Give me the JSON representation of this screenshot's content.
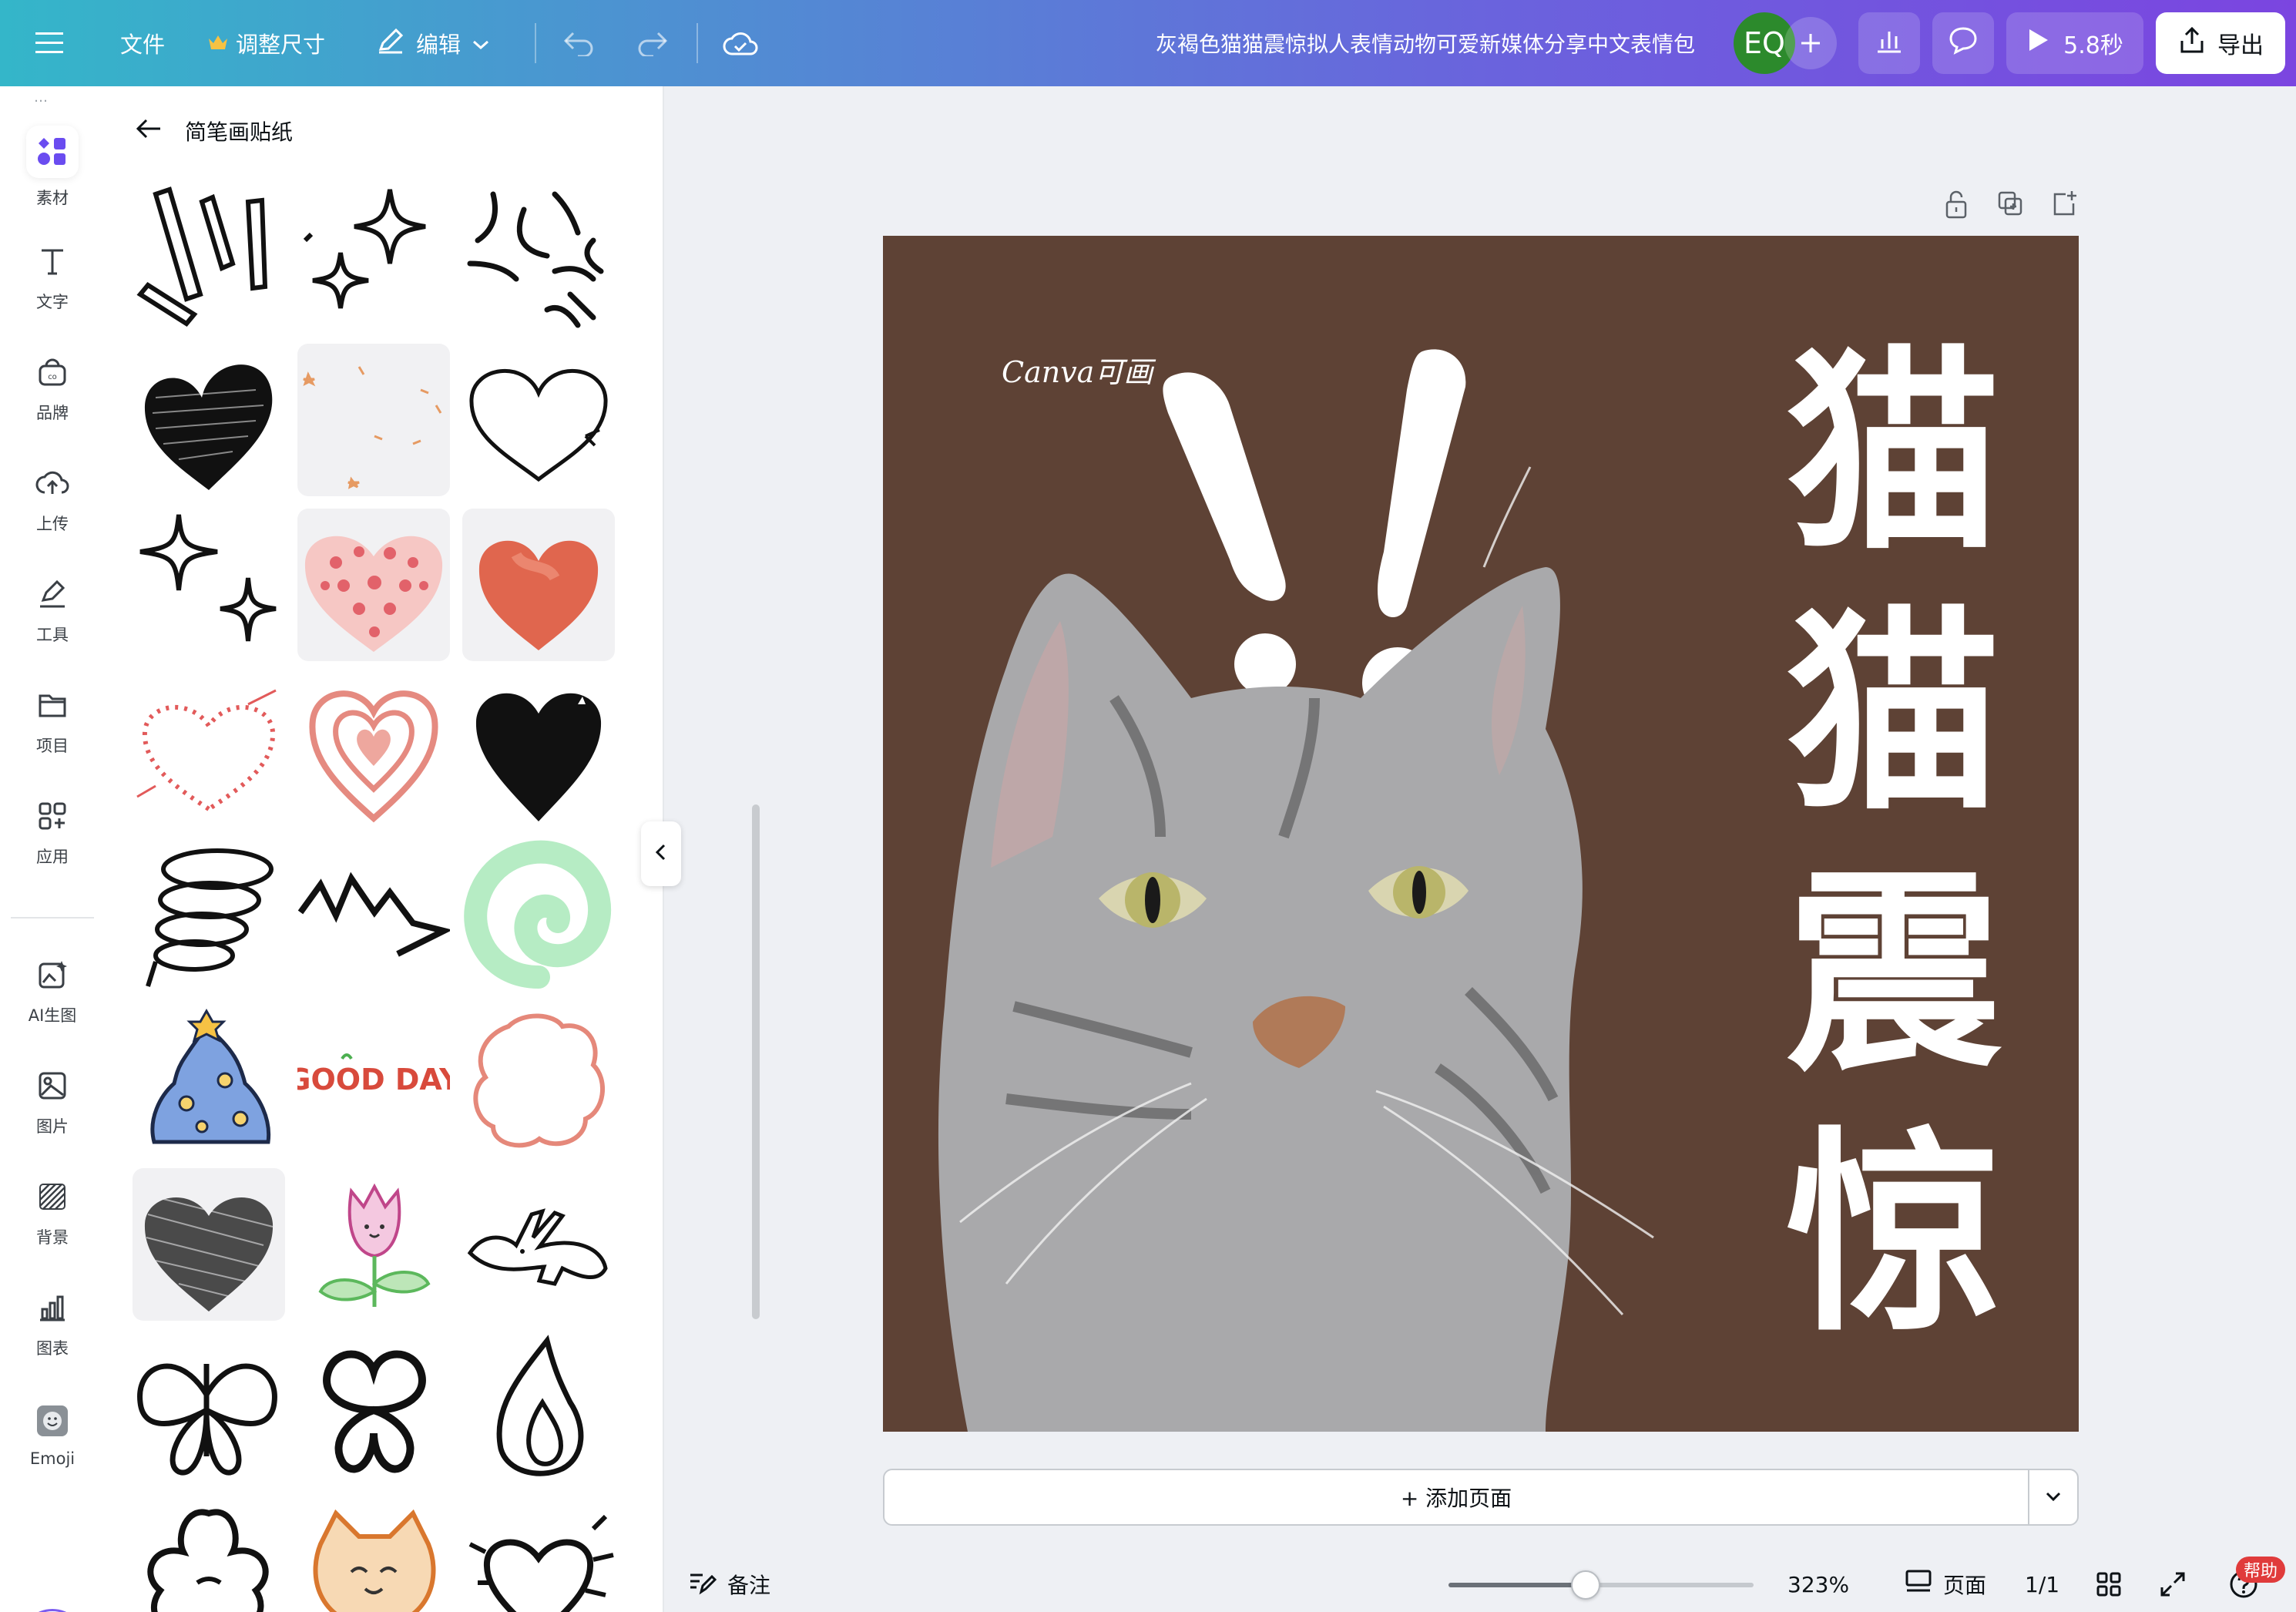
{
  "topbar": {
    "menu_icon": "hamburger-icon",
    "file_label": "文件",
    "resize_label": "调整尺寸",
    "edit_label": "编辑",
    "design_title": "灰褐色猫猫震惊拟人表情动物可爱新媒体分享中文表情包",
    "avatar_initials": "EQ",
    "play_label": "5.8秒",
    "export_label": "导出",
    "crown_color": "#f6c244"
  },
  "rail": {
    "items": [
      {
        "label": "素材",
        "icon": "elements-icon"
      },
      {
        "label": "文字",
        "icon": "text-icon"
      },
      {
        "label": "品牌",
        "icon": "brand-icon"
      },
      {
        "label": "上传",
        "icon": "upload-icon"
      },
      {
        "label": "工具",
        "icon": "draw-tool-icon"
      },
      {
        "label": "项目",
        "icon": "folder-icon"
      },
      {
        "label": "应用",
        "icon": "apps-icon"
      },
      {
        "label": "AI生图",
        "icon": "ai-image-icon"
      },
      {
        "label": "图片",
        "icon": "image-icon"
      },
      {
        "label": "背景",
        "icon": "background-icon"
      },
      {
        "label": "图表",
        "icon": "chart-icon"
      },
      {
        "label": "Emoji",
        "icon": "emoji-icon"
      }
    ],
    "accent": "#6a4cf0"
  },
  "panel": {
    "title": "简笔画贴纸",
    "good_day_text": "GOOD DAY"
  },
  "canvas": {
    "background_color": "#5e4235",
    "vertical_text": [
      "猫",
      "猫",
      "震",
      "惊"
    ],
    "logo_text": "Canva可画",
    "add_page_label": "+ 添加页面"
  },
  "bottombar": {
    "notes_label": "备注",
    "zoom_value": "323%",
    "zoom_fraction": 0.45,
    "pages_label": "页面",
    "page_count": "1/1",
    "help_label": "帮助"
  }
}
